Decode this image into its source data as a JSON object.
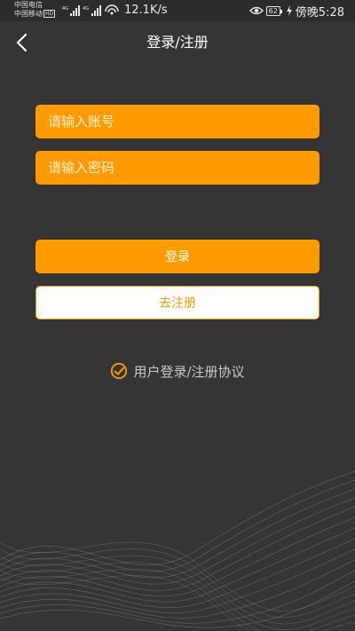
{
  "status_bar": {
    "carrier_1": "中国电信",
    "carrier_2": "中国移动",
    "hd_badge": "HD",
    "network_1": "4G",
    "network_2": "4G",
    "net_speed": "12.1K/s",
    "battery": "62",
    "time": "傍晚5:28"
  },
  "header": {
    "title": "登录/注册"
  },
  "form": {
    "account_placeholder": "请输入账号",
    "password_placeholder": "请输入密码",
    "account_value": "",
    "password_value": ""
  },
  "buttons": {
    "login_label": "登录",
    "register_label": "去注册"
  },
  "agreement": {
    "text": "用户登录/注册协议",
    "checked": true
  },
  "colors": {
    "background": "#353535",
    "accent": "#ff9b00",
    "text_light": "#ffffff",
    "muted_text": "#c8c8c8"
  }
}
